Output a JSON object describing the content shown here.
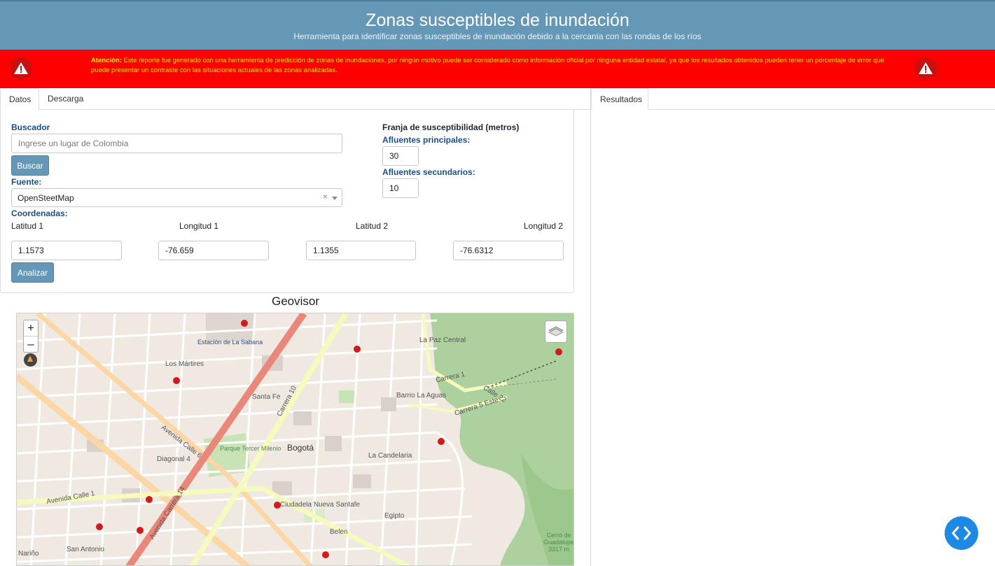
{
  "header": {
    "title": "Zonas susceptibles de inundación",
    "subtitle": "Herramienta para identificar zonas susceptibles de inundación debido a la cercanía con las rondas de los ríos"
  },
  "warning": {
    "label": "Atención:",
    "text": " Este reporte fue generado con una herramienta de predicción de zonas de inundaciones, por ningún motivo puede ser considerado como información oficial por ninguna entidad estatal, ya que los resultados obtenidos pueden tener un porcentaje de error que puede presentar un contraste con las situaciones actuales de las zonas analizadas.",
    "icon_left": "warning-icon",
    "icon_right": "warning-icon"
  },
  "tabs_left": [
    "Datos",
    "Descarga"
  ],
  "tabs_right": [
    "Resultados"
  ],
  "form": {
    "buscador_label": "Buscador",
    "buscador_placeholder": "Ingrese un lugar de Colombia",
    "buscar_button": "Buscar",
    "fuente_label": "Fuente:",
    "fuente_value": "OpenSteetMap",
    "fuente_clear": "×",
    "coordenadas_label": "Coordenadas:",
    "lat1_label": "Latitud 1",
    "lon1_label": "Longitud 1",
    "lat2_label": "Latitud 2",
    "lon2_label": "Longitud 2",
    "lat1_value": "1.1573",
    "lon1_value": "-76.659",
    "lat2_value": "1.1355",
    "lon2_value": "-76.6312",
    "analizar_button": "Analizar",
    "franja_label": "Franja de susceptibilidad (metros)",
    "principales_label": "Afluentes principales:",
    "principales_value": "30",
    "secundarios_label": "Afluentes secundarios:",
    "secundarios_value": "10"
  },
  "map": {
    "title": "Geovisor",
    "zoom_in": "+",
    "zoom_out": "–",
    "labels": {
      "estacion": "Estación de La Sabana",
      "martires": "Los Mártires",
      "santafe": "Santa Fe",
      "bogota": "Bogotá",
      "candelaria": "La Candelaria",
      "pazcentral": "La Paz Central",
      "barrio": "Barrio La Aguas",
      "parque": "Parque Tercer Milenio",
      "ciudadela": "Ciudadela Nueva Santafe",
      "egipto": "Egipto",
      "belen": "Belen",
      "sanantonio": "San Antonio",
      "narino": "Nariño",
      "cerro": "Cerro de Guadalupe 3317 m",
      "carrera10": "Carrera 10",
      "avcalle6": "Avenida Calle 6",
      "avcalle1": "Avenida Calle 1",
      "diagonal4": "Diagonal 4",
      "carrera14": "Avenida Carrera 14",
      "carrera1": "Carrera 1",
      "calle22": "Calle 22",
      "carrera5": "Carrera 5 Este"
    }
  },
  "colors": {
    "header": "#6598b7",
    "warning_bg": "#ff0000",
    "warning_text": "#ffd400",
    "button": "#6598b7",
    "label_blue": "#1a4e86",
    "fab": "#1d89e4"
  }
}
